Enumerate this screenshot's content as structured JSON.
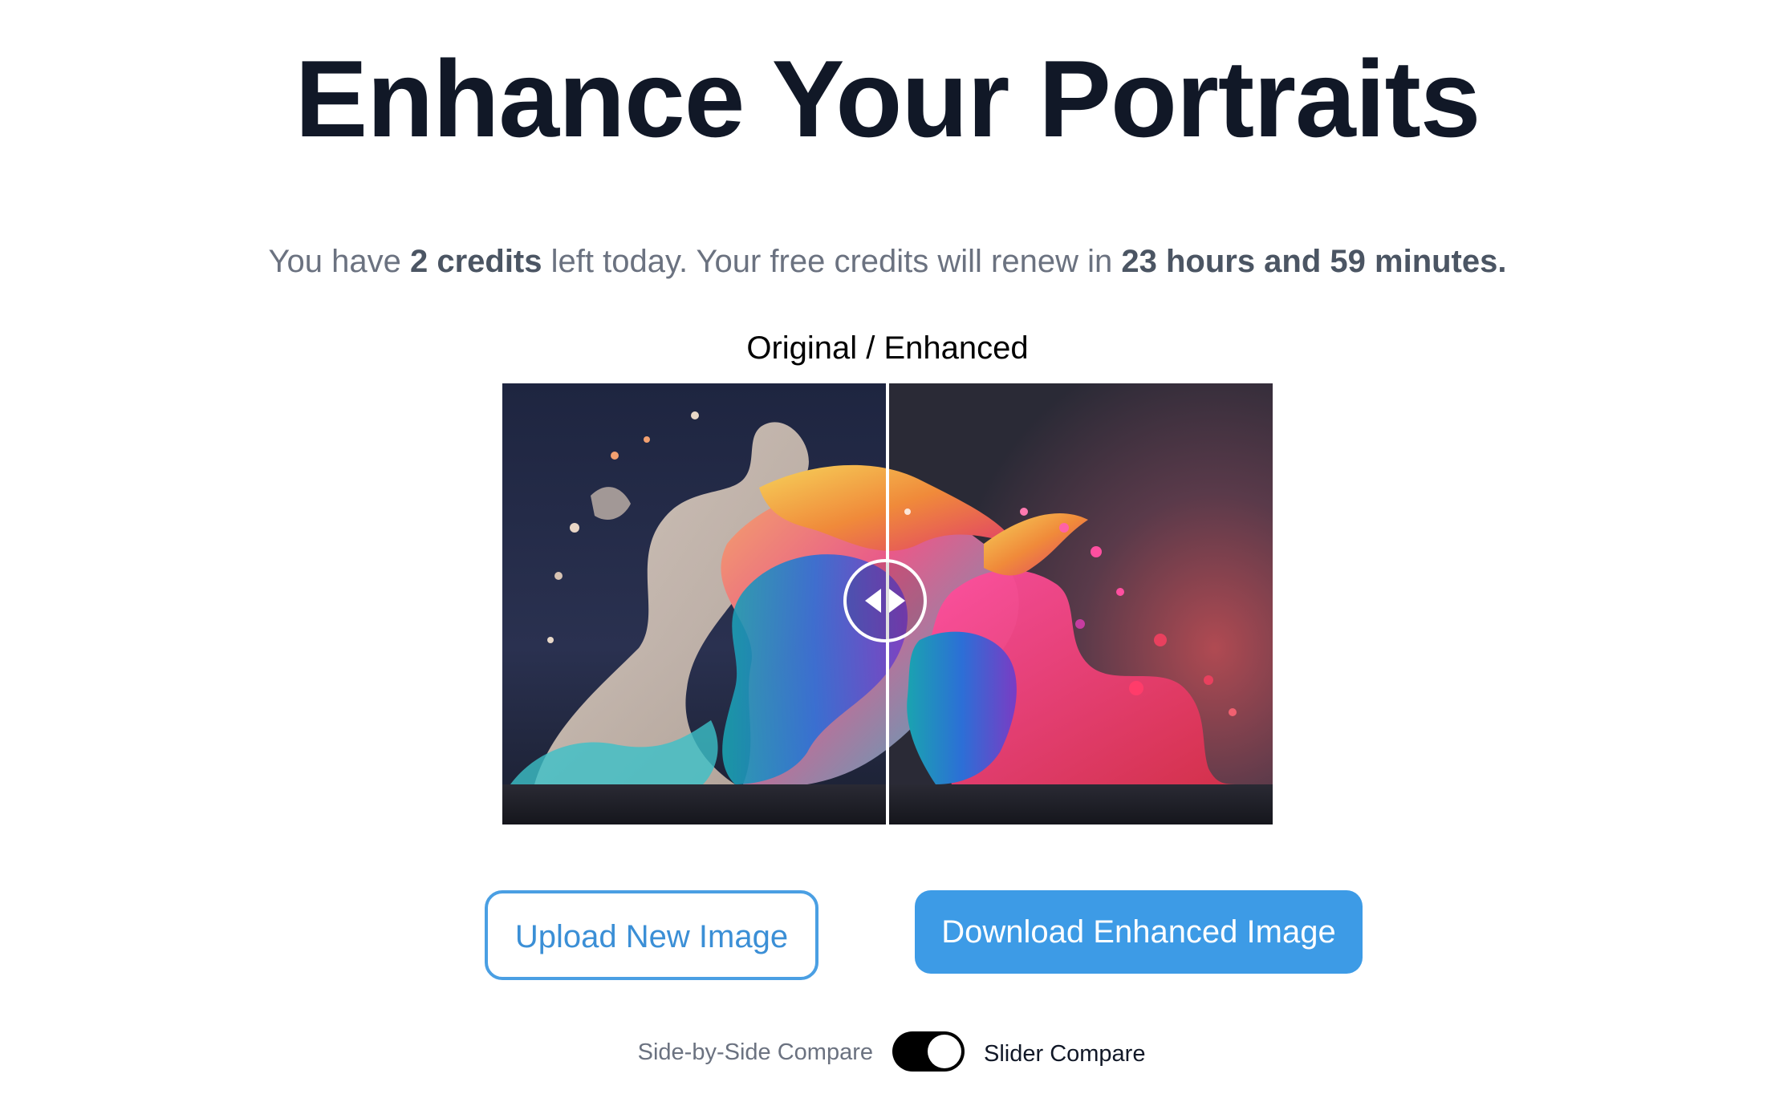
{
  "page": {
    "title": "Enhance Your Portraits"
  },
  "credits": {
    "prefix": "You have ",
    "credits_count": "2 credits",
    "middle": " left today. Your free credits will renew in ",
    "renew_time": "23 hours and 59 minutes."
  },
  "viewer": {
    "label": "Original / Enhanced",
    "slider_position": 0.5,
    "handle_icon": "left-right-arrows-icon"
  },
  "actions": {
    "upload_label": "Upload New Image",
    "download_label": "Download Enhanced Image"
  },
  "compare_toggle": {
    "left_label": "Side-by-Side Compare",
    "right_label": "Slider Compare",
    "selected": "Slider Compare"
  },
  "colors": {
    "title": "#111827",
    "muted_text": "#6b7280",
    "accent": "#3d9be6",
    "toggle_on": "#000000"
  }
}
